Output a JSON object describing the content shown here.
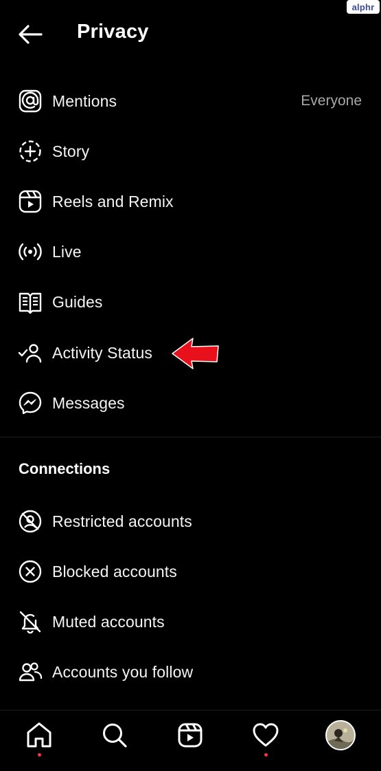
{
  "watermark": "alphr",
  "header": {
    "title": "Privacy"
  },
  "privacy_items": [
    {
      "label": "Mentions",
      "value": "Everyone",
      "icon": "at-sign-icon"
    },
    {
      "label": "Story",
      "icon": "story-add-icon"
    },
    {
      "label": "Reels and Remix",
      "icon": "reels-icon"
    },
    {
      "label": "Live",
      "icon": "live-broadcast-icon"
    },
    {
      "label": "Guides",
      "icon": "guides-book-icon"
    },
    {
      "label": "Activity Status",
      "icon": "activity-status-icon"
    },
    {
      "label": "Messages",
      "icon": "messenger-icon"
    }
  ],
  "connections": {
    "title": "Connections",
    "items": [
      {
        "label": "Restricted accounts",
        "icon": "restricted-icon"
      },
      {
        "label": "Blocked accounts",
        "icon": "blocked-icon"
      },
      {
        "label": "Muted accounts",
        "icon": "muted-bell-icon"
      },
      {
        "label": "Accounts you follow",
        "icon": "people-icon"
      }
    ]
  },
  "bottom_nav": [
    "home-icon",
    "search-icon",
    "reels-icon",
    "heart-icon",
    "profile-avatar"
  ],
  "colors": {
    "background": "#000000",
    "text": "#ffffff",
    "muted": "#a8a8a8",
    "notification_dot": "#ff3040",
    "arrow": "#e8101a"
  }
}
